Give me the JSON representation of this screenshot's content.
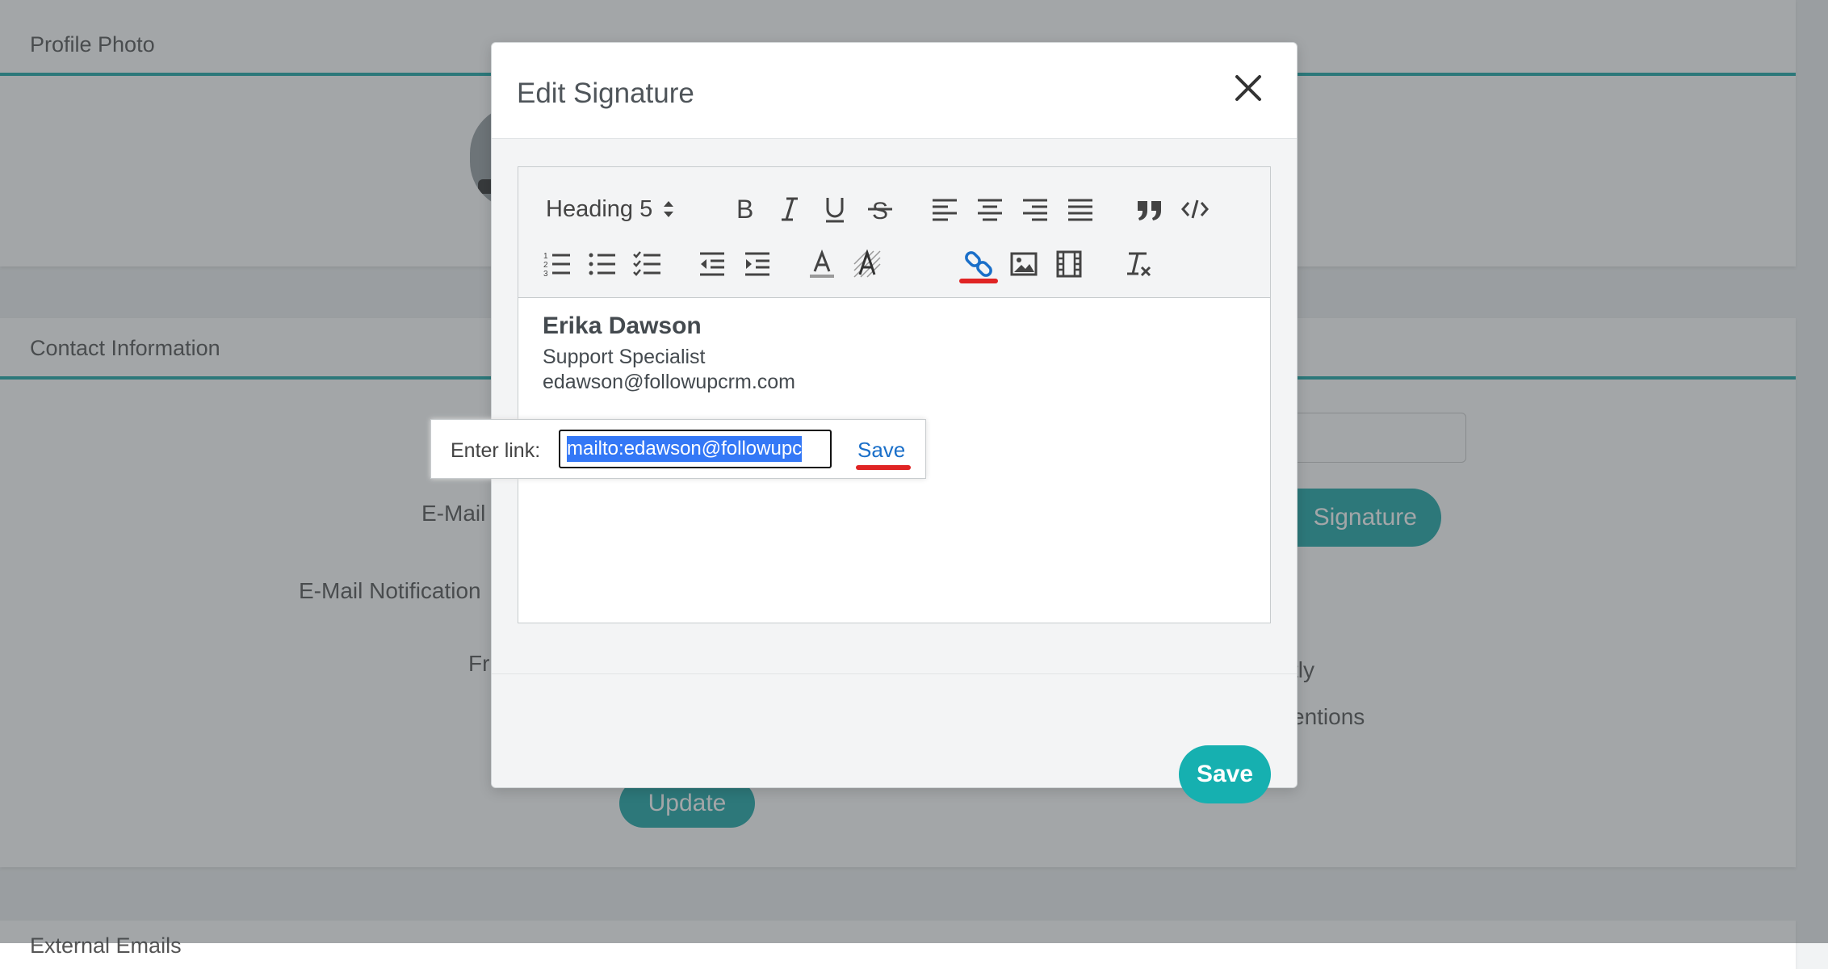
{
  "background": {
    "profile_card_title": "Profile Photo",
    "contact_card_title": "Contact Information",
    "email_label": "E-Mail",
    "notification_label": "E-Mail Notification",
    "freq_label_partial": "Fr",
    "signature_button_partial": "Signature",
    "option_partial_1": "tly",
    "option_partial_2": "entions",
    "update_button": "Update",
    "bottom_card_title_partial": "External Emails"
  },
  "modal": {
    "title": "Edit Signature",
    "save_button": "Save"
  },
  "toolbar": {
    "heading_select_value": "Heading 5",
    "accent_color": "#1a6fc9"
  },
  "signature": {
    "name": "Erika Dawson",
    "title": "Support Specialist",
    "email": "edawson@followupcrm.com"
  },
  "link_popup": {
    "label": "Enter link:",
    "input_value": "mailto:edawson@followupc",
    "save_label": "Save"
  },
  "colors": {
    "teal": "#16b0b0",
    "highlight": "#e02424"
  }
}
